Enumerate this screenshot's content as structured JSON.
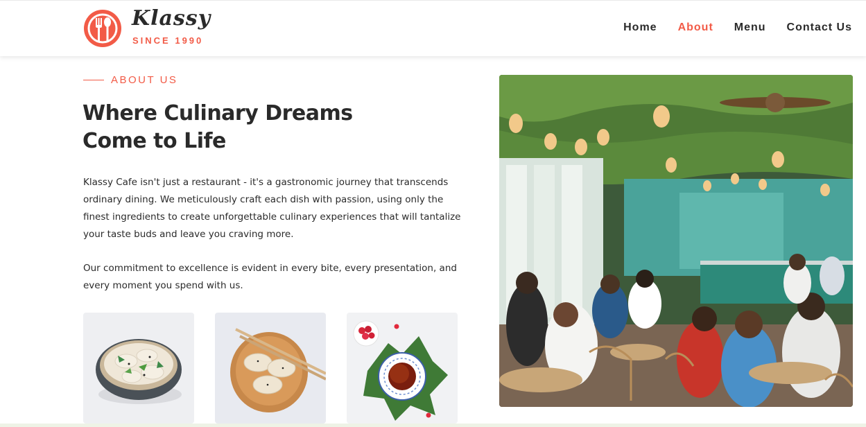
{
  "brand": {
    "name": "Klassy",
    "tagline": "SINCE 1990",
    "accent_color": "#f25b47"
  },
  "nav": {
    "items": [
      {
        "label": "Home",
        "active": false
      },
      {
        "label": "About",
        "active": true
      },
      {
        "label": "Menu",
        "active": false
      },
      {
        "label": "Contact Us",
        "active": false
      }
    ]
  },
  "about": {
    "eyebrow": "ABOUT US",
    "title_line1": "Where Culinary Dreams",
    "title_line2": "Come to Life",
    "paragraph1": "Klassy Cafe isn't just a restaurant - it's a gastronomic journey that transcends ordinary dining. We meticulously craft each dish with passion, using only the finest ingredients to create unforgettable culinary experiences that will tantalize your taste buds and leave you craving more.",
    "paragraph2": "Our commitment to excellence is evident in every bite, every presentation, and every moment you spend with us."
  },
  "thumbnails": [
    {
      "icon": "dumplings-bowl-image"
    },
    {
      "icon": "dumplings-chopsticks-image"
    },
    {
      "icon": "tea-cup-berries-image"
    }
  ],
  "main_image": {
    "icon": "restaurant-interior-photo"
  }
}
